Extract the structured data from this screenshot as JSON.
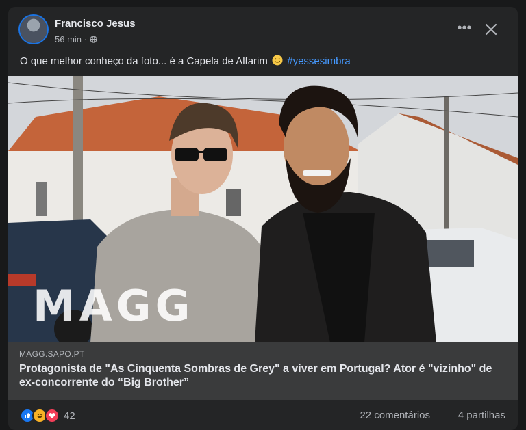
{
  "post": {
    "author": "Francisco Jesus",
    "time": "56 min ·",
    "text": "O que melhor conheço da foto... é a Capela de Alfarim",
    "hashtag": "#yessesimbra"
  },
  "icons": {
    "more": "more-options-icon",
    "close": "close-icon",
    "audience": "globe-icon",
    "emoji": "smiling-face-icon"
  },
  "photo": {
    "watermark": "MAGG"
  },
  "link": {
    "domain": "MAGG.SAPO.PT",
    "headline": "Protagonista de \"As Cinquenta Sombras de Grey\" a viver em Portugal? Ator é \"vizinho\" de ex-concorrente do “Big Brother”"
  },
  "stats": {
    "reactions_count": "42",
    "comments": "22 comentários",
    "shares": "4 partilhas"
  },
  "colors": {
    "background": "#18191a",
    "card": "#242526",
    "link_box": "#3a3b3c",
    "hashtag": "#4599ff",
    "like": "#1877f2",
    "love": "#f33e58",
    "haha": "#f7b125"
  }
}
